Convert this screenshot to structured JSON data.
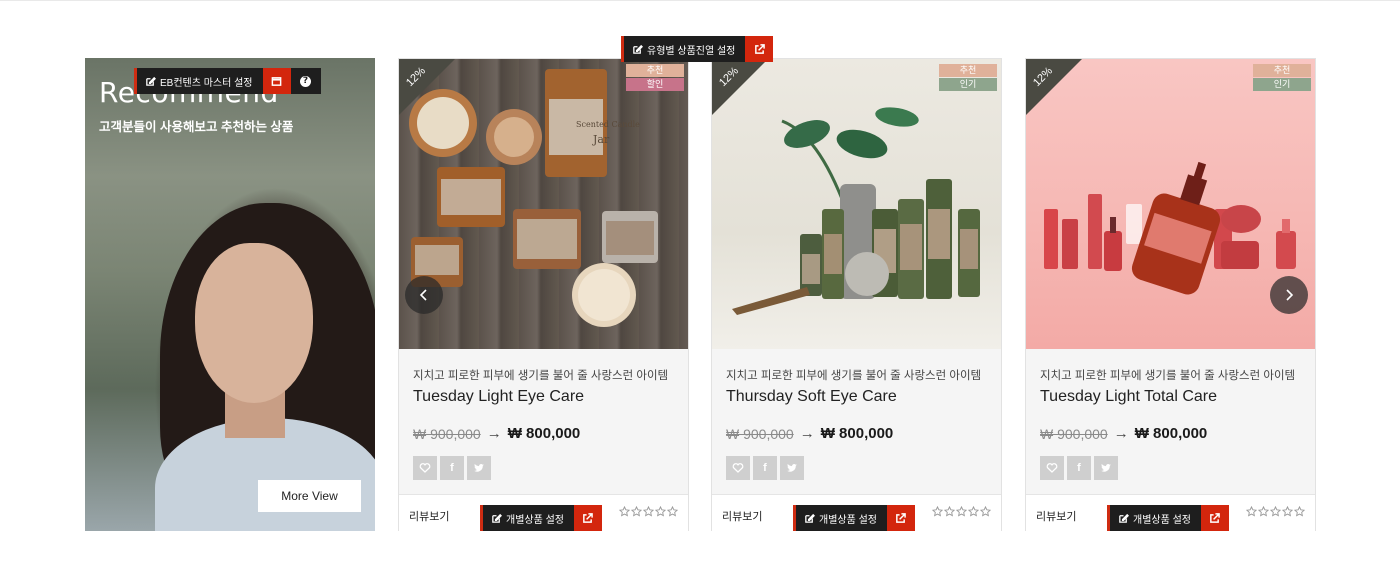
{
  "banner": {
    "title": "Recommend",
    "subtitle": "고객분들이 사용해보고 추천하는 상품",
    "button_label": "More View"
  },
  "admin": {
    "eb_master_label": "EB컨텐츠 마스터 설정",
    "type_display_label": "유형별 상품진열 설정",
    "item_setting_label": "개별상품 설정"
  },
  "products": [
    {
      "discount": "12%",
      "tags": [
        {
          "label": "추천",
          "color": "#e0b19a"
        },
        {
          "label": "할인",
          "color": "#c7738a"
        }
      ],
      "description": "지치고 피로한 피부에 생기를 불어 줄 사랑스런 아이템",
      "name": "Tuesday Light Eye Care",
      "old_price": "₩ 900,000",
      "new_price": "₩ 800,000",
      "review_label": "리뷰보기"
    },
    {
      "discount": "12%",
      "tags": [
        {
          "label": "추천",
          "color": "#e0b19a"
        },
        {
          "label": "인기",
          "color": "#8ea58d"
        }
      ],
      "description": "지치고 피로한 피부에 생기를 불어 줄 사랑스런 아이템",
      "name": "Thursday Soft Eye Care",
      "old_price": "₩ 900,000",
      "new_price": "₩ 800,000",
      "review_label": "리뷰보기"
    },
    {
      "discount": "12%",
      "tags": [
        {
          "label": "추천",
          "color": "#e0b19a"
        },
        {
          "label": "인기",
          "color": "#8ea58d"
        }
      ],
      "description": "지치고 피로한 피부에 생기를 불어 줄 사랑스런 아이템",
      "name": "Tuesday Light Total Care",
      "old_price": "₩ 900,000",
      "new_price": "₩ 800,000",
      "review_label": "리뷰보기"
    }
  ],
  "product_image_labels": {
    "candle_jar": "Scented Candle Jar"
  },
  "icons": {
    "edit": "edit-icon",
    "external": "external-link-icon",
    "window": "window-icon",
    "help": "question-icon",
    "heart": "heart-icon",
    "facebook": "facebook-icon",
    "twitter": "twitter-icon",
    "star": "star-outline-icon",
    "prev": "chevron-left-icon",
    "next": "chevron-right-icon"
  },
  "colors": {
    "admin_dark": "#1e1e1e",
    "admin_red": "#d3260d",
    "ribbon": "#4a4a42"
  }
}
